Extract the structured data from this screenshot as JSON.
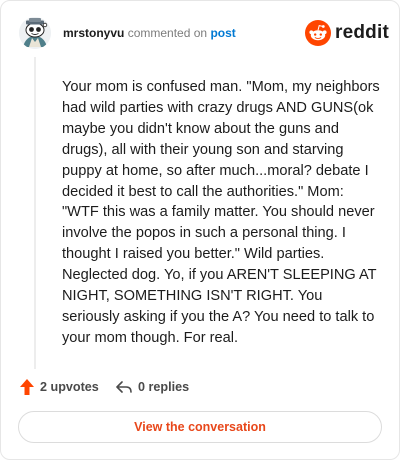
{
  "comment": {
    "username": "mrstonyvu",
    "action_text": "commented on",
    "target_label": "post",
    "body": "Your mom is confused man. \"Mom, my neighbors had wild parties with crazy drugs AND GUNS(ok maybe you didn't know about the guns and drugs), all with their young son and starving puppy at home, so after much...moral? debate I decided it best to call the authorities.\" Mom: \"WTF this was a family matter. You should never involve the popos in such a personal thing. I thought I raised you better.\" Wild parties. Neglected dog. Yo, if you AREN'T SLEEPING AT NIGHT, SOMETHING ISN'T RIGHT. You seriously asking if you the A? You need to talk to your mom though. For real."
  },
  "brand": {
    "wordmark": "reddit",
    "icon": "reddit-snoo-icon",
    "color": "#ff4500"
  },
  "footer": {
    "upvotes_label": "2 upvotes",
    "upvote_icon": "upvote-arrow-icon",
    "upvote_color": "#ff4500",
    "replies_label": "0 replies",
    "reply_icon": "reply-arrow-icon",
    "cta_label": "View the conversation",
    "cta_color": "#e8471a"
  },
  "avatar": {
    "icon": "snoo-avatar-icon"
  }
}
